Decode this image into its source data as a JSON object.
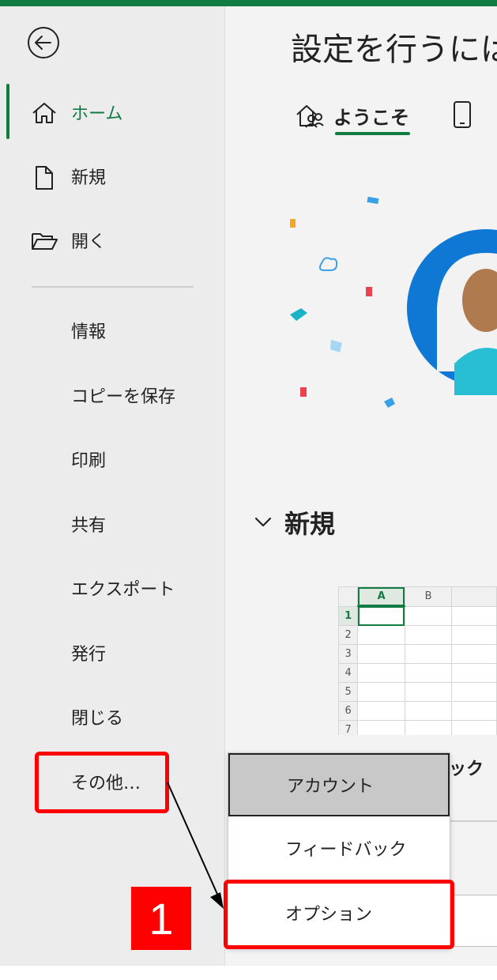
{
  "sidebar": {
    "items": [
      {
        "label": "ホーム",
        "icon": "home-icon",
        "active": true
      },
      {
        "label": "新規",
        "icon": "new-document-icon"
      },
      {
        "label": "開く",
        "icon": "open-folder-icon"
      },
      {
        "label": "情報"
      },
      {
        "label": "コピーを保存"
      },
      {
        "label": "印刷"
      },
      {
        "label": "共有"
      },
      {
        "label": "エクスポート"
      },
      {
        "label": "発行"
      },
      {
        "label": "閉じる"
      },
      {
        "label": "その他…"
      }
    ]
  },
  "main": {
    "title": "設定を行うには",
    "tabs": [
      {
        "label": "ようこそ",
        "icon": "welcome-icon",
        "selected": true
      },
      {
        "label": "",
        "icon": "phone-icon"
      }
    ],
    "section": {
      "label": "新規",
      "icon": "chevron-down-icon"
    },
    "workbook_thumb": {
      "columns": [
        "A",
        "B"
      ],
      "rows": [
        "1",
        "2",
        "3",
        "4",
        "5",
        "6",
        "7"
      ],
      "selected_cell": "A1"
    },
    "peek_label": "ック"
  },
  "popup": {
    "items": [
      {
        "label": "アカウント",
        "hover": true
      },
      {
        "label": "フィードバック"
      },
      {
        "label": "オプション"
      }
    ]
  },
  "annotation": {
    "step_number": "1",
    "color": "#ff0000"
  },
  "colors": {
    "accent": "#107c41",
    "sidebar_bg": "#ececec",
    "main_bg": "#f3f3f3"
  }
}
